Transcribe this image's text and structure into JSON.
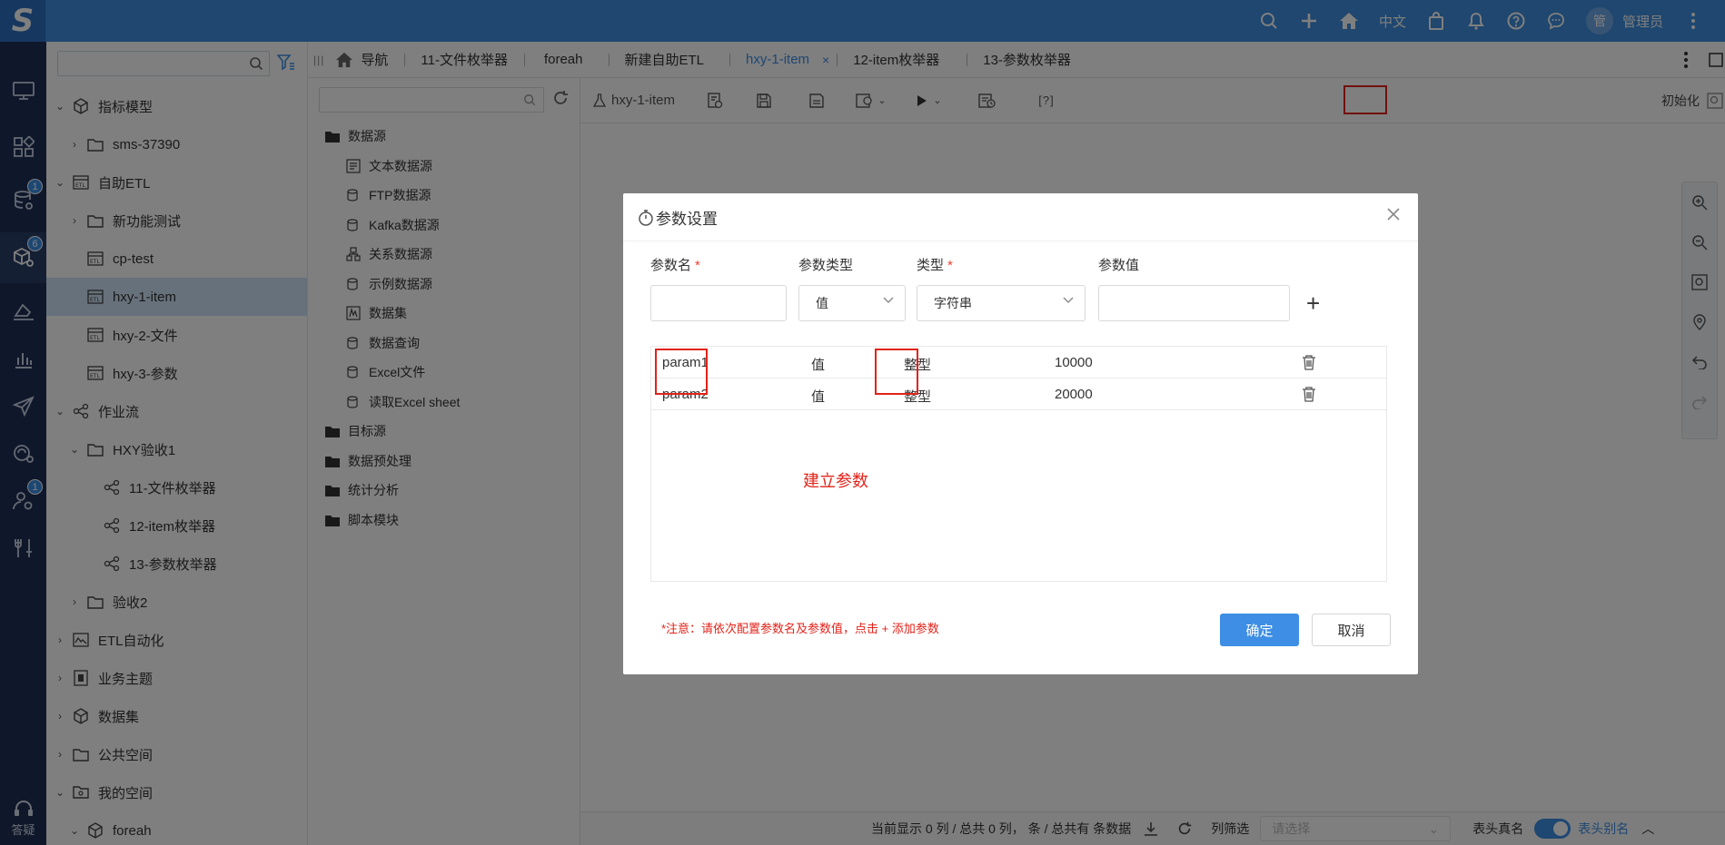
{
  "topbar": {
    "logo": "S",
    "lang": "中文",
    "avatar_char": "管",
    "username": "管理员"
  },
  "rail": {
    "badges": [
      "1",
      "6",
      "1"
    ],
    "help_label": "答疑"
  },
  "sidebar": {
    "items": [
      {
        "label": "指标模型"
      },
      {
        "label": "sms-37390"
      },
      {
        "label": "自助ETL"
      },
      {
        "label": "新功能测试"
      },
      {
        "label": "cp-test"
      },
      {
        "label": "hxy-1-item"
      },
      {
        "label": "hxy-2-文件"
      },
      {
        "label": "hxy-3-参数"
      },
      {
        "label": "作业流"
      },
      {
        "label": "HXY验收1"
      },
      {
        "label": "11-文件枚举器"
      },
      {
        "label": "12-item枚举器"
      },
      {
        "label": "13-参数枚举器"
      },
      {
        "label": "验收2"
      },
      {
        "label": "ETL自动化"
      },
      {
        "label": "业务主题"
      },
      {
        "label": "数据集"
      },
      {
        "label": "公共空间"
      },
      {
        "label": "我的空间"
      },
      {
        "label": "foreah"
      }
    ]
  },
  "tabs": [
    {
      "label": "导航"
    },
    {
      "label": "11-文件枚举器"
    },
    {
      "label": "foreah"
    },
    {
      "label": "新建自助ETL"
    },
    {
      "label": "hxy-1-item",
      "close": "×"
    },
    {
      "label": "12-item枚举器"
    },
    {
      "label": "13-参数枚举器"
    }
  ],
  "nodes": {
    "groups": [
      {
        "label": "数据源"
      },
      {
        "label": "目标源"
      },
      {
        "label": "数据预处理"
      },
      {
        "label": "统计分析"
      },
      {
        "label": "脚本模块"
      }
    ],
    "datasource_items": [
      {
        "label": "文本数据源"
      },
      {
        "label": "FTP数据源"
      },
      {
        "label": "Kafka数据源"
      },
      {
        "label": "关系数据源"
      },
      {
        "label": "示例数据源"
      },
      {
        "label": "数据集"
      },
      {
        "label": "数据查询"
      },
      {
        "label": "Excel文件"
      },
      {
        "label": "读取Excel sheet"
      }
    ]
  },
  "toolbar": {
    "node_name": "hxy-1-item",
    "param_button": "[?]",
    "init_label": "初始化"
  },
  "bottom": {
    "summary": "当前显示 0 列 / 总共 0 列， 条 / 总共有 条数据",
    "col_filter": "列筛选",
    "select_placeholder": "请选择",
    "header_real": "表头真名",
    "header_alias": "表头别名"
  },
  "dialog": {
    "title": "参数设置",
    "labels": {
      "name": "参数名",
      "param_type": "参数类型",
      "type": "类型",
      "value": "参数值"
    },
    "required_mark": "*",
    "param_type_value": "值",
    "type_value": "字符串",
    "add_symbol": "+",
    "rows": [
      {
        "name": "param1",
        "param_type": "值",
        "type": "整型",
        "value": "10000"
      },
      {
        "name": "param2",
        "param_type": "值",
        "type": "整型",
        "value": "20000"
      }
    ],
    "annotation": "建立参数",
    "note": "*注意：请依次配置参数名及参数值，点击 + 添加参数",
    "ok": "确定",
    "cancel": "取消"
  },
  "colors": {
    "topbar": "#3f8fdf",
    "rail": "#1f3055",
    "accent": "#3d8ee4",
    "annotation_red": "#e2231a"
  }
}
